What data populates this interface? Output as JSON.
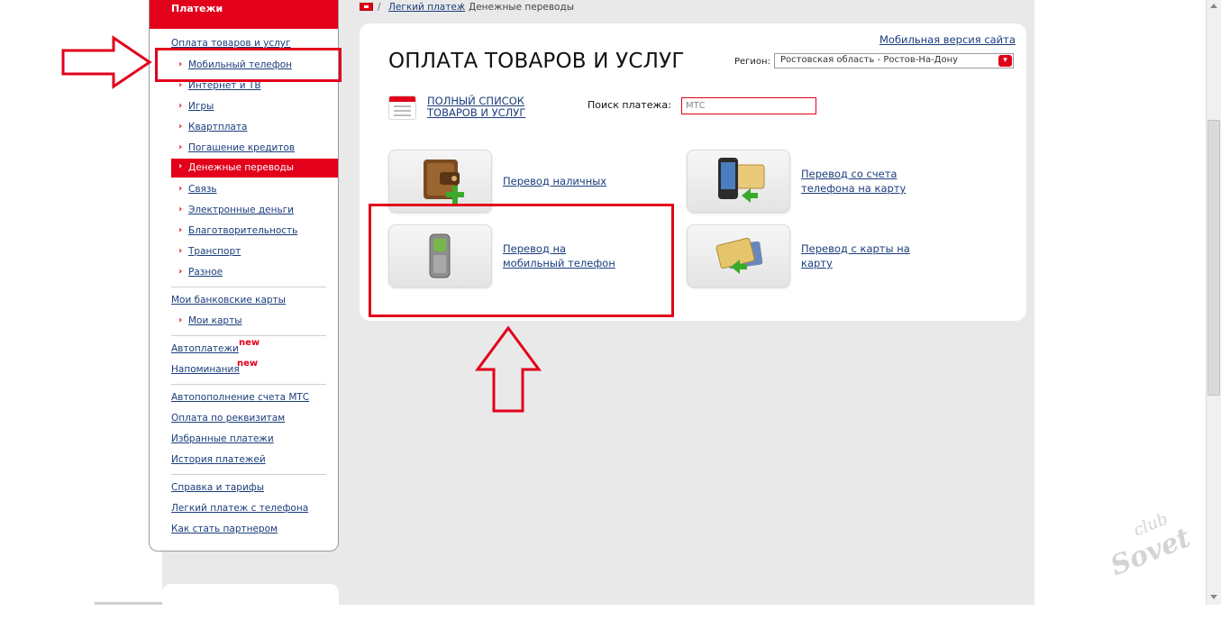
{
  "sidebar": {
    "header": "Платежи",
    "section_title": "Оплата товаров и услуг",
    "sub_items": [
      {
        "label": "Мобильный телефон"
      },
      {
        "label": "Интернет и ТВ"
      },
      {
        "label": "Игры"
      },
      {
        "label": "Квартплата"
      },
      {
        "label": "Погашение кредитов"
      },
      {
        "label": "Денежные переводы"
      },
      {
        "label": "Связь"
      },
      {
        "label": "Электронные деньги"
      },
      {
        "label": "Благотворительность"
      },
      {
        "label": "Транспорт"
      },
      {
        "label": "Разное"
      }
    ],
    "bank_cards": "Мои банковские карты",
    "my_cards": "Мои карты",
    "autopay": "Автоплатежи",
    "reminders": "Напоминания",
    "new_badge": "new",
    "links_group1": [
      "Автопополнение счета МТС",
      "Оплата по реквизитам",
      "Избранные платежи",
      "История платежей"
    ],
    "links_group2": [
      "Справка и тарифы",
      "Легкий платеж с телефона",
      "Как стать партнером"
    ]
  },
  "breadcrumb": {
    "sep": "/",
    "link": "Легкий платеж",
    "current": "Денежные переводы"
  },
  "main": {
    "mobile_version": "Мобильная версия сайта",
    "title": "ОПЛАТА ТОВАРОВ И УСЛУГ",
    "region_label": "Регион:",
    "region_value": "Ростовская область - Ростов-На-Дону",
    "full_list_line1": "ПОЛНЫЙ СПИСОК",
    "full_list_line2": "ТОВАРОВ И УСЛУГ",
    "search_label": "Поиск платежа:",
    "search_value": "МТС",
    "tiles": [
      {
        "icon": "wallet-plus-icon",
        "line1": "Перевод наличных",
        "line2": ""
      },
      {
        "icon": "phone-to-card-icon",
        "line1": "Перевод со счета",
        "line2": "телефона на карту"
      },
      {
        "icon": "mobile-phone-icon",
        "line1": "Перевод на",
        "line2": "мобильный телефон"
      },
      {
        "icon": "card-to-card-icon",
        "line1": "Перевод с карты на",
        "line2": "карту"
      }
    ]
  },
  "watermark": {
    "line1": "club",
    "line2": "Sovet"
  },
  "colors": {
    "brand_red": "#e2001a",
    "link_blue": "#1a3d7c",
    "background_gray": "#e9e9e9"
  }
}
